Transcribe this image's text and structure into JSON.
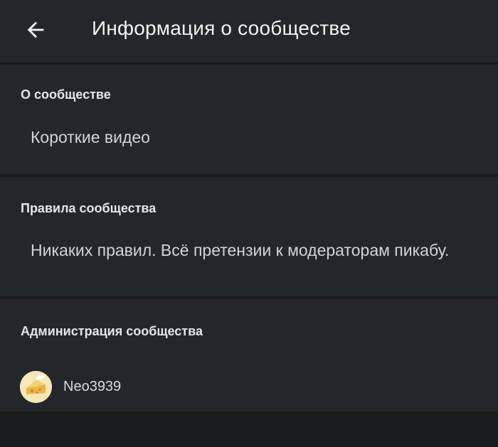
{
  "header": {
    "back_icon": "arrow-left-icon",
    "title": "Информация о сообществе"
  },
  "about": {
    "heading": "О сообществе",
    "text": "Короткие видео"
  },
  "rules": {
    "heading": "Правила сообщества",
    "text": "Никаких правил. Всё претензии к модераторам пикабу."
  },
  "administration": {
    "heading": "Администрация сообщества",
    "admins": [
      {
        "name": "Neo3939",
        "avatar": "cheese-avatar"
      }
    ]
  },
  "colors": {
    "background": "#1b1c1e",
    "panel": "#23272b",
    "text_primary": "#f1f2f3",
    "text_secondary": "#d2d4d6",
    "avatar_bg": "#f4e3b3"
  }
}
